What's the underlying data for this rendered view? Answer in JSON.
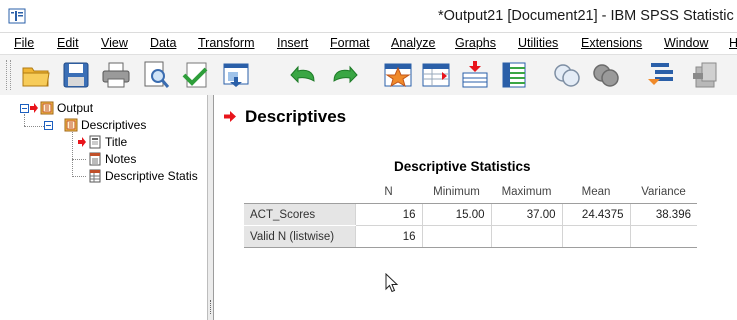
{
  "window": {
    "title": "*Output21 [Document21] - IBM SPSS Statistic",
    "app_icon": "spss-output-icon"
  },
  "menu": [
    {
      "label": "File",
      "id": "file"
    },
    {
      "label": "Edit",
      "id": "edit"
    },
    {
      "label": "View",
      "id": "view"
    },
    {
      "label": "Data",
      "id": "data"
    },
    {
      "label": "Transform",
      "id": "transform"
    },
    {
      "label": "Insert",
      "id": "insert"
    },
    {
      "label": "Format",
      "id": "format"
    },
    {
      "label": "Analyze",
      "id": "analyze"
    },
    {
      "label": "Graphs",
      "id": "graphs"
    },
    {
      "label": "Utilities",
      "id": "utilities"
    },
    {
      "label": "Extensions",
      "id": "extensions"
    },
    {
      "label": "Window",
      "id": "window"
    },
    {
      "label": "H",
      "id": "help"
    }
  ],
  "toolbar": {
    "buttons": [
      "open-folder-icon",
      "save-icon",
      "print-icon",
      "print-preview-icon",
      "export-icon",
      "recall-dialog-icon",
      "undo-icon",
      "redo-icon",
      "goto-data-icon",
      "goto-case-icon",
      "goto-variable-icon",
      "variables-icon",
      "show-output-icon",
      "hide-output-icon",
      "promote-icon",
      "demote-icon"
    ]
  },
  "outline": {
    "items": [
      {
        "label": "Output",
        "icon": "output-book-icon"
      },
      {
        "label": "Descriptives",
        "icon": "procedure-book-icon"
      },
      {
        "label": "Title",
        "icon": "title-doc-icon"
      },
      {
        "label": "Notes",
        "icon": "notes-doc-icon"
      },
      {
        "label": "Descriptive Statis",
        "icon": "table-doc-icon"
      }
    ]
  },
  "content": {
    "section_title": "Descriptives",
    "table_title": "Descriptive Statistics",
    "table": {
      "columns": [
        "",
        "N",
        "Minimum",
        "Maximum",
        "Mean",
        "Variance"
      ],
      "rows": [
        {
          "label": "ACT_Scores",
          "N": "16",
          "Minimum": "15.00",
          "Maximum": "37.00",
          "Mean": "24.4375",
          "Variance": "38.396"
        },
        {
          "label": "Valid N (listwise)",
          "N": "16",
          "Minimum": "",
          "Maximum": "",
          "Mean": "",
          "Variance": ""
        }
      ]
    }
  },
  "colors": {
    "arrow_red": "#e8141b",
    "tree_blue": "#1c5fbf",
    "row_label_bg": "#e5e5e5"
  }
}
